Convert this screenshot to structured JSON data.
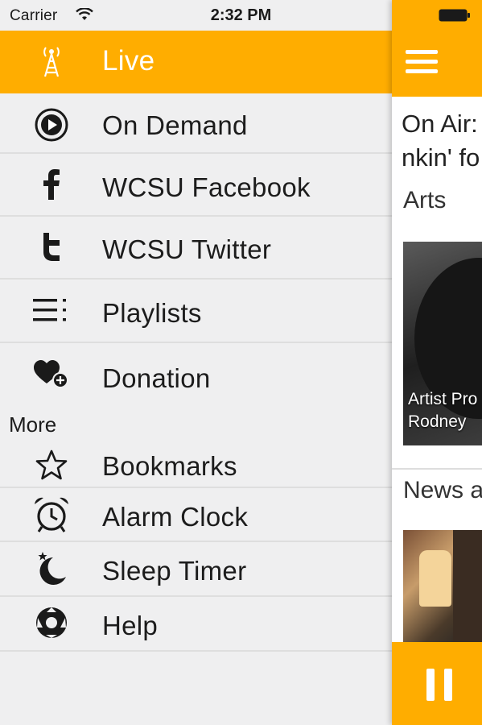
{
  "status_bar": {
    "carrier": "Carrier",
    "time": "2:32 PM"
  },
  "menu": {
    "items": [
      {
        "label": "Live",
        "icon": "antenna-icon",
        "active": true
      },
      {
        "label": "On Demand",
        "icon": "play-circle-icon"
      },
      {
        "label": "WCSU  Facebook",
        "icon": "facebook-icon"
      },
      {
        "label": "WCSU Twitter",
        "icon": "twitter-icon"
      },
      {
        "label": "Playlists",
        "icon": "list-icon"
      },
      {
        "label": "Donation",
        "icon": "heart-plus-icon"
      }
    ],
    "more_heading": "More",
    "more_items": [
      {
        "label": "Bookmarks",
        "icon": "star-icon"
      },
      {
        "label": "Alarm Clock",
        "icon": "alarm-clock-icon"
      },
      {
        "label": "Sleep Timer",
        "icon": "moon-icon"
      },
      {
        "label": "Help",
        "icon": "lifebuoy-icon"
      }
    ]
  },
  "panel": {
    "on_air_line1": "On Air:",
    "on_air_line2": "nkin' fo",
    "section_arts": "Arts",
    "card1_caption_line1": "Artist Pro",
    "card1_caption_line2": "Rodney",
    "section_news": "News a"
  },
  "colors": {
    "accent": "#ffad00",
    "menu_bg": "#efeff0",
    "separator": "#dedede"
  }
}
